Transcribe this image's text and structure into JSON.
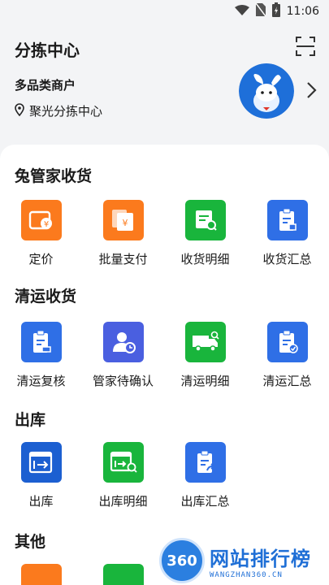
{
  "status_bar": {
    "time": "11:06",
    "wifi_icon": "wifi-icon",
    "sim_icon": "no-sim-icon",
    "battery_icon": "battery-charging-icon"
  },
  "header": {
    "title": "分拣中心",
    "merchant": "多品类商户",
    "location": "聚光分拣中心"
  },
  "sections": [
    {
      "title": "兔管家收货",
      "items": [
        {
          "label": "定价",
          "icon": "pricing-icon",
          "color": "#fb7a1d"
        },
        {
          "label": "批量支付",
          "icon": "batch-pay-icon",
          "color": "#fb7a1d"
        },
        {
          "label": "收货明细",
          "icon": "receipt-detail-icon",
          "color": "#19b53c"
        },
        {
          "label": "收货汇总",
          "icon": "receipt-summary-icon",
          "color": "#2f6fe6"
        }
      ]
    },
    {
      "title": "清运收货",
      "items": [
        {
          "label": "清运复核",
          "icon": "clearance-review-icon",
          "color": "#2f6fe6"
        },
        {
          "label": "管家待确认",
          "icon": "steward-pending-icon",
          "color": "#4a5fe0"
        },
        {
          "label": "清运明细",
          "icon": "truck-detail-icon",
          "color": "#19b53c"
        },
        {
          "label": "清运汇总",
          "icon": "clearance-summary-icon",
          "color": "#2f6fe6"
        }
      ]
    },
    {
      "title": "出库",
      "items": [
        {
          "label": "出库",
          "icon": "outbound-icon",
          "color": "#1c5fd1"
        },
        {
          "label": "出库明细",
          "icon": "outbound-detail-icon",
          "color": "#19b53c"
        },
        {
          "label": "出库汇总",
          "icon": "outbound-summary-icon",
          "color": "#2f6fe6"
        }
      ]
    },
    {
      "title": "其他",
      "items": []
    }
  ],
  "watermark": {
    "logo": "360",
    "title": "网站排行榜",
    "subtitle": "WANGZHAN360.CN"
  }
}
